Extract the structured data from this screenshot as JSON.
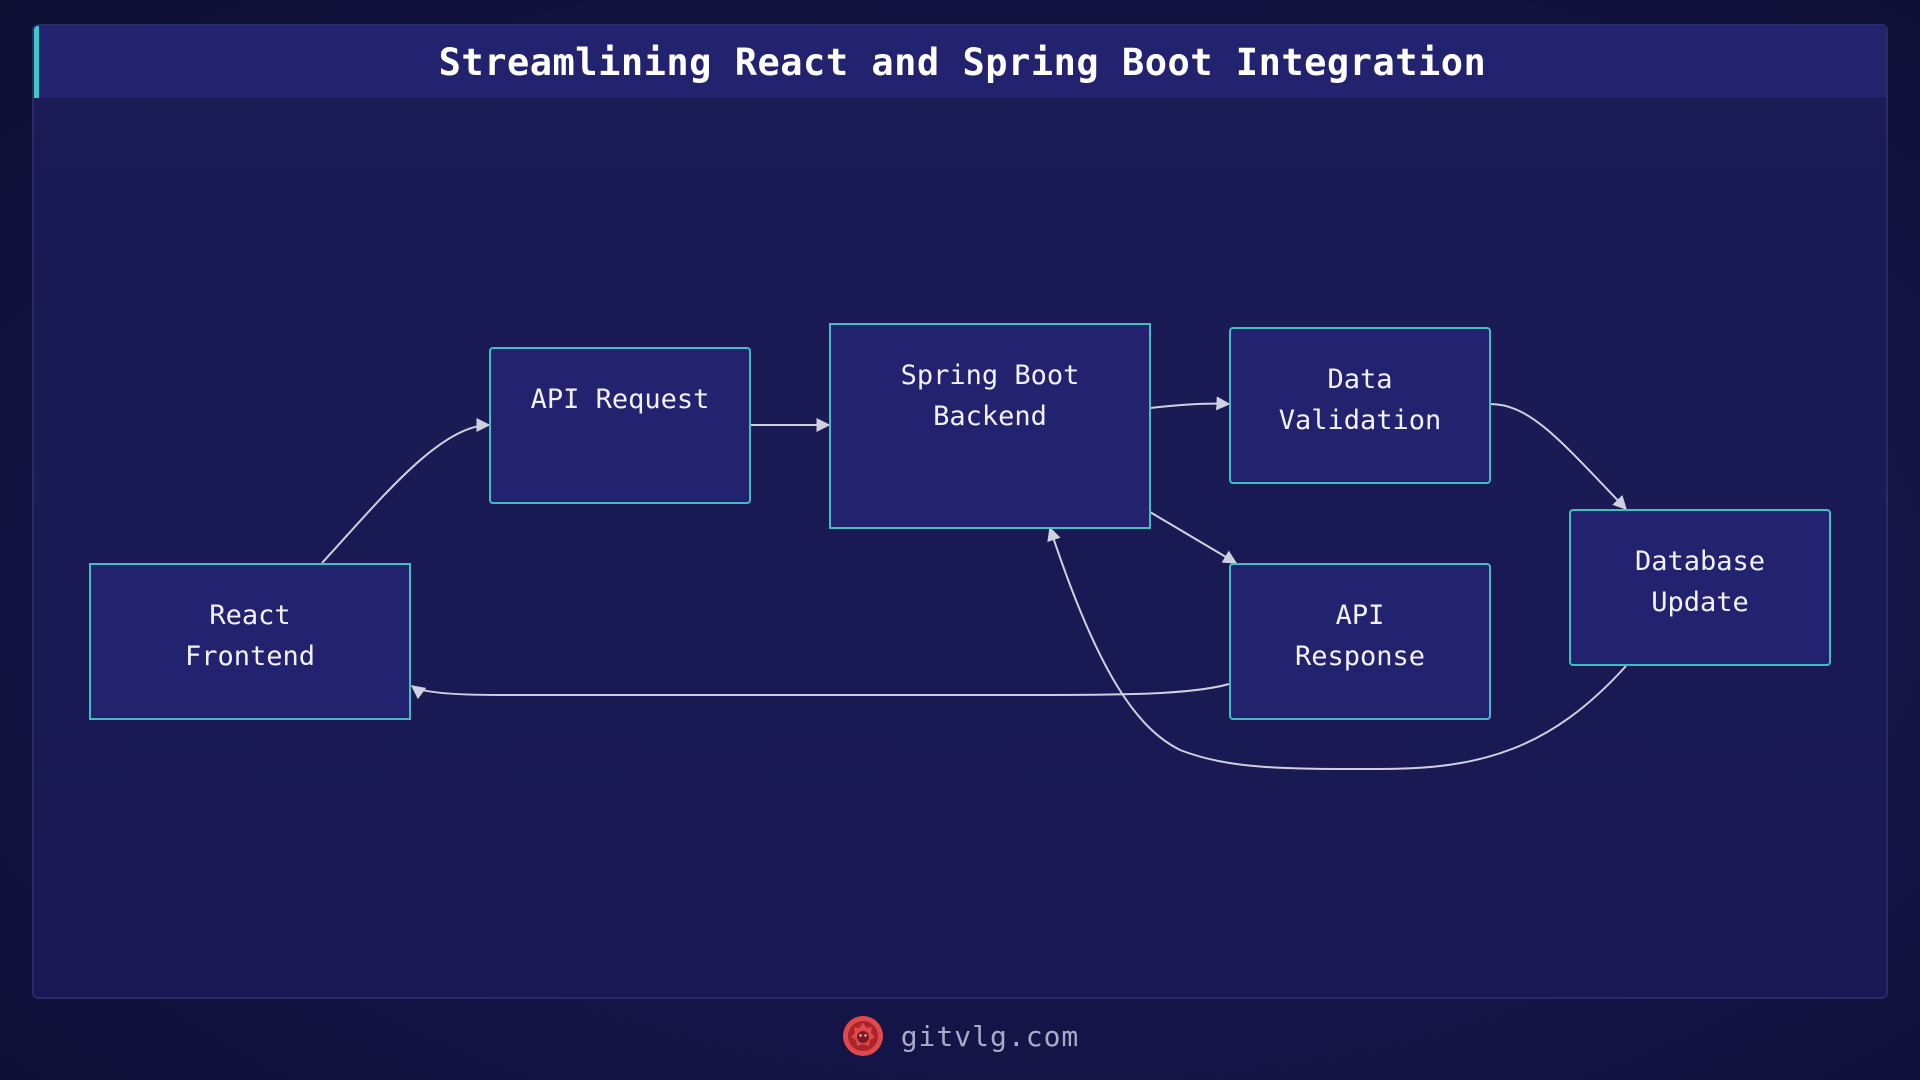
{
  "header": {
    "title": "Streamlining React and Spring Boot Integration"
  },
  "nodes": {
    "react_frontend": "React\nFrontend",
    "api_request": "API Request",
    "spring_boot_backend": "Spring Boot\nBackend",
    "data_validation": "Data\nValidation",
    "api_response": "API\nResponse",
    "database_update": "Database\nUpdate"
  },
  "edges": [
    {
      "from": "React Frontend",
      "to": "API Request"
    },
    {
      "from": "API Request",
      "to": "Spring Boot Backend"
    },
    {
      "from": "Spring Boot Backend",
      "to": "Data Validation"
    },
    {
      "from": "Spring Boot Backend",
      "to": "API Response"
    },
    {
      "from": "Data Validation",
      "to": "Database Update"
    },
    {
      "from": "Database Update",
      "to": "Spring Boot Backend"
    },
    {
      "from": "API Response",
      "to": "React Frontend"
    }
  ],
  "footer": {
    "site": "gitvlg.com",
    "logo": "lion-logo-icon"
  },
  "colors": {
    "background": "#141446",
    "title_bar": "#22226f",
    "accent": "#3dc7c9",
    "node_fill": "#22226f",
    "node_border": "#3fbfc4",
    "edge": "#d0d0e0",
    "logo": "#e0484c"
  }
}
